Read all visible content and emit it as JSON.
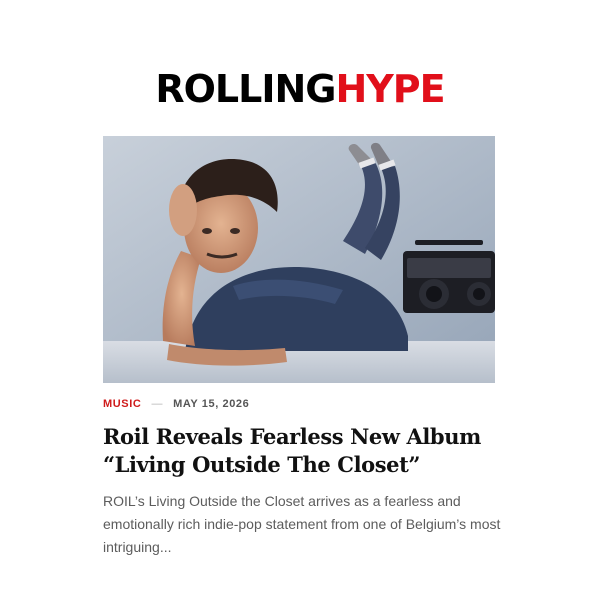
{
  "site": {
    "logo_part1": "ROLLING",
    "logo_part2": "HYPE",
    "brand_colors": {
      "primary": "#000000",
      "accent": "#e10f1a"
    }
  },
  "article": {
    "category": "MUSIC",
    "separator": "—",
    "date": "MAY 15, 2026",
    "title": "Roil Reveals Fearless New Album “Living Outside The Closet”",
    "excerpt": "ROIL’s Living Outside the Closet arrives as a fearless and emotionally rich indie-pop statement from one of Belgium’s most intriguing...",
    "image_subject": "man-lying-on-floor-with-boombox",
    "category_color": "#cf1b1b"
  }
}
